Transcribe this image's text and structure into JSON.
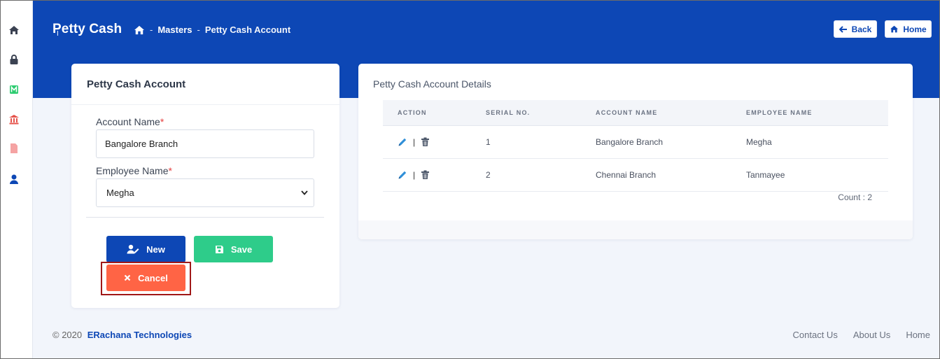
{
  "header": {
    "title": "Petty Cash",
    "breadcrumb": {
      "sep": "-",
      "masters": "Masters",
      "current": "Petty Cash Account"
    },
    "back_label": "Back",
    "home_label": "Home"
  },
  "sidebar": {
    "items": [
      {
        "icon": "home-icon"
      },
      {
        "icon": "lock-icon"
      },
      {
        "icon": "m-badge-icon"
      },
      {
        "icon": "bank-icon"
      },
      {
        "icon": "document-icon"
      },
      {
        "icon": "user-icon"
      }
    ]
  },
  "form": {
    "title": "Petty Cash Account",
    "account_label": "Account Name",
    "employee_label": "Employee Name",
    "required_mark": "*",
    "account_value": "Bangalore Branch",
    "employee_value": "Megha",
    "new_label": "New",
    "save_label": "Save",
    "cancel_label": "Cancel"
  },
  "details": {
    "title": "Petty Cash Account Details",
    "columns": [
      "ACTION",
      "SERIAL NO.",
      "ACCOUNT NAME",
      "EMPLOYEE NAME"
    ],
    "rows": [
      {
        "serial": "1",
        "account": "Bangalore Branch",
        "employee": "Megha"
      },
      {
        "serial": "2",
        "account": "Chennai Branch",
        "employee": "Tanmayee"
      }
    ],
    "action_separator": "|",
    "count_label": "Count : 2"
  },
  "footer": {
    "copyright": "© 2020",
    "company": "ERachana Technologies",
    "links": [
      "Contact Us",
      "About Us",
      "Home"
    ]
  },
  "colors": {
    "primary": "#0d47b5",
    "success": "#2ecc8a",
    "danger": "#ff6445",
    "highlight_border": "#a01818"
  }
}
